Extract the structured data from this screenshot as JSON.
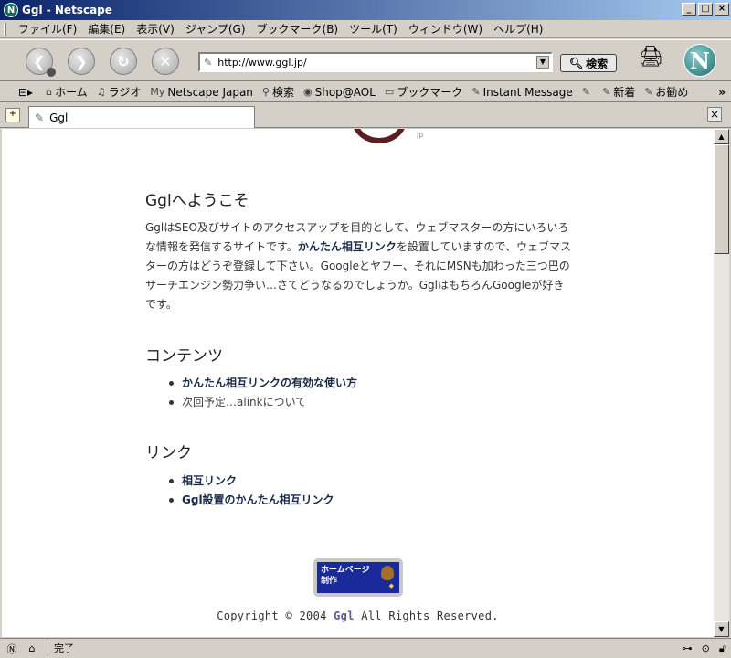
{
  "window": {
    "title": "Ggl - Netscape",
    "buttons": {
      "minimize": "_",
      "maximize": "□",
      "close": "×"
    }
  },
  "menubar": {
    "items": [
      "ファイル(F)",
      "編集(E)",
      "表示(V)",
      "ジャンプ(G)",
      "ブックマーク(B)",
      "ツール(T)",
      "ウィンドウ(W)",
      "ヘルプ(H)"
    ]
  },
  "navbar": {
    "back_icon": "back-arrow-icon",
    "forward_icon": "forward-arrow-icon",
    "reload_icon": "reload-icon",
    "stop_icon": "stop-icon",
    "url": "http://www.ggl.jp/",
    "search_label": "検索"
  },
  "personal_toolbar": {
    "items": [
      {
        "icon": "home-icon",
        "label": "ホーム"
      },
      {
        "icon": "radio-icon",
        "label": "ラジオ"
      },
      {
        "icon": "my-icon",
        "label": "Netscape Japan"
      },
      {
        "icon": "search-icon",
        "label": "検索"
      },
      {
        "icon": "aol-icon",
        "label": "Shop@AOL"
      },
      {
        "icon": "folder-icon",
        "label": "ブックマーク"
      },
      {
        "icon": "bookmark-icon",
        "label": "Instant Message"
      },
      {
        "icon": "bookmark-icon",
        "label": ""
      },
      {
        "icon": "bookmark-icon",
        "label": "新着"
      },
      {
        "icon": "bookmark-icon",
        "label": "お勧め"
      }
    ],
    "more": "»"
  },
  "tabs": {
    "active_label": "Ggl"
  },
  "page": {
    "welcome_heading": "Gglへようこそ",
    "intro_part1": "GglはSEO及びサイトのアクセスアップを目的として、ウェブマスターの方にいろいろな情報を発信するサイトです。",
    "intro_link": "かんたん相互リンク",
    "intro_part2": "を設置していますので、ウェブマスターの方はどうぞ登録して下さい。Googleとヤフー、それにMSNも加わった三つ巴のサーチエンジン勢力争い…さてどうなるのでしょうか。GglはもちろんGoogleが好きです。",
    "contents_heading": "コンテンツ",
    "contents_items": [
      {
        "label": "かんたん相互リンクの有効な使い方",
        "link": true
      },
      {
        "label": "次回予定…alinkについて",
        "link": false
      }
    ],
    "links_heading": "リンク",
    "links_items": [
      {
        "label": "相互リンク"
      },
      {
        "label": "Ggl設置のかんたん相互リンク"
      }
    ],
    "banner_text_1": "ホームページ",
    "banner_text_2": "制作",
    "copyright_prefix": "Copyright © 2004 ",
    "copyright_brand": "Ggl",
    "copyright_suffix": " All Rights Reserved."
  },
  "statusbar": {
    "status_text": "完了"
  }
}
